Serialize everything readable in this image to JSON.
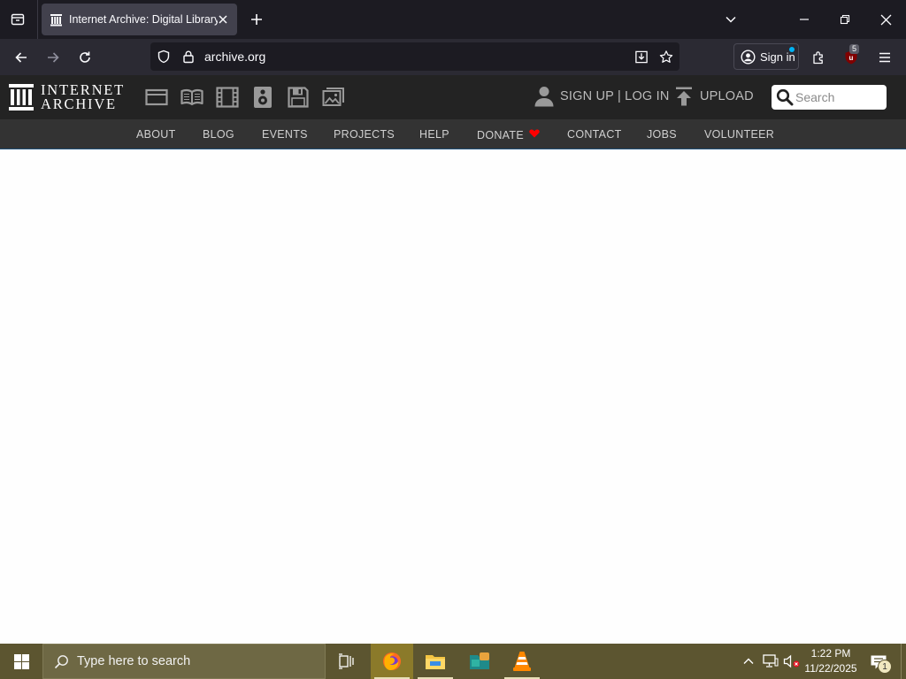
{
  "browser": {
    "tab": {
      "title": "Internet Archive: Digital Library"
    },
    "url": "archive.org",
    "signin_label": "Sign in",
    "extension_badge": "5"
  },
  "archive_header": {
    "logo_line1": "INTERNET",
    "logo_line2": "ARCHIVE",
    "media_icons": [
      "web-icon",
      "texts-icon",
      "video-icon",
      "audio-icon",
      "software-icon",
      "images-icon"
    ],
    "signup_login": "SIGN UP | LOG IN",
    "upload": "UPLOAD",
    "search_placeholder": "Search"
  },
  "archive_nav": {
    "items": [
      {
        "label": "ABOUT"
      },
      {
        "label": "BLOG"
      },
      {
        "label": "EVENTS"
      },
      {
        "label": "PROJECTS"
      },
      {
        "label": "HELP"
      },
      {
        "label": "DONATE"
      },
      {
        "label": "CONTACT"
      },
      {
        "label": "JOBS"
      },
      {
        "label": "VOLUNTEER"
      }
    ],
    "donate_heart_color": "#ff0000"
  },
  "taskbar": {
    "search_placeholder": "Type here to search",
    "time": "1:22 PM",
    "date": "11/22/2025",
    "notification_count": "1"
  },
  "colors": {
    "tabstrip_bg": "#1c1b22",
    "toolbar_bg": "#2b2a33",
    "archive_header_bg": "#232323",
    "archive_nav_bg": "#333333",
    "taskbar_bg": "#5c5530"
  }
}
